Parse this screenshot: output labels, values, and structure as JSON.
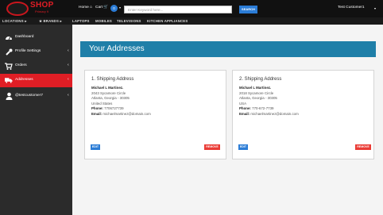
{
  "brand": {
    "name": "SHOP",
    "tagline": "Primary 9"
  },
  "nav": {
    "home_label": "Home",
    "cart_label": "Cart",
    "cart_count": "0",
    "search_placeholder": "Enter Keyword here...",
    "search_button": "SEARCH",
    "user_label": "Test Customer1"
  },
  "categories": [
    "LOCATIONS",
    "BRANDS",
    "LAPTOPS",
    "MOBILES",
    "TELEVISIONS",
    "KITCHEN APPLIANCES"
  ],
  "sidebar": {
    "items": [
      {
        "label": "Dashboard",
        "icon": "dashboard-icon"
      },
      {
        "label": "Profile Settings",
        "icon": "wrench-icon"
      },
      {
        "label": "Orders",
        "icon": "cart-icon"
      },
      {
        "label": "Addresses",
        "icon": "truck-icon"
      },
      {
        "label": "@testcustomer7",
        "icon": "user-icon"
      }
    ]
  },
  "page": {
    "title": "Your Addresses"
  },
  "addresses": [
    {
      "title": "1. Shipping Address",
      "name": "Michael L Martinez.",
      "street": "2043 Sycamore Circle",
      "city": "Atlanta, Georgia - 30305",
      "country": "United States",
      "phone_label": "Phone:",
      "phone": "7706727739",
      "email_label": "Email:",
      "email": "michaelmartinez@domain.com",
      "edit": "EDIT",
      "remove": "REMOVE"
    },
    {
      "title": "2. Shipping Address",
      "name": "Michael L Martinez.",
      "street": "2018 Sycamore Circle",
      "city": "Atlanta, Georgia - 30305",
      "country": "USA",
      "phone_label": "Phone:",
      "phone": "770-672-7739",
      "email_label": "Email:",
      "email": "michaelmartinez@domain.com",
      "edit": "EDIT",
      "remove": "REMOVE"
    }
  ],
  "colors": {
    "brand_red": "#e01e25",
    "header_blue": "#1f7fa8",
    "button_blue": "#2b7cd6",
    "remove_red": "#ea3b35"
  }
}
